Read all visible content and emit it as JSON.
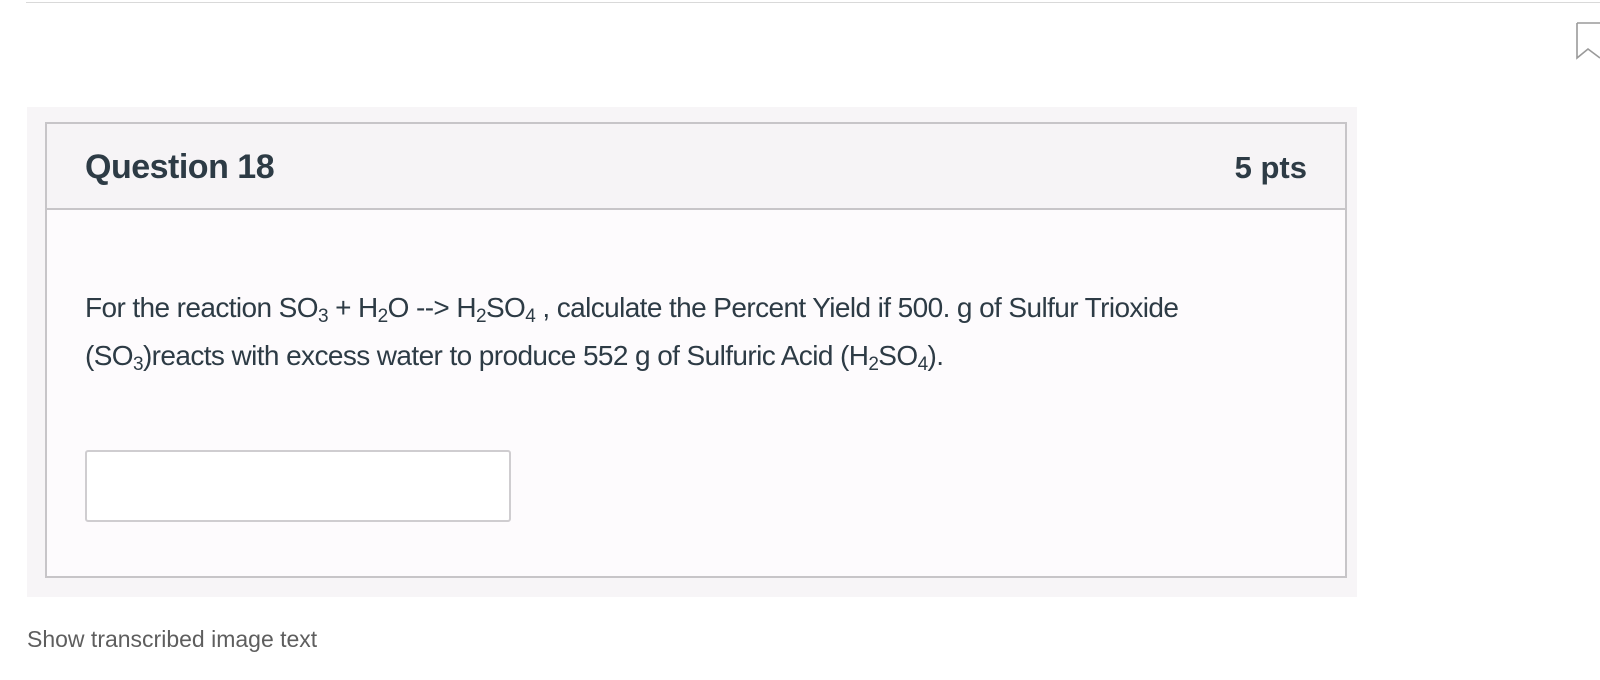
{
  "question": {
    "title": "Question 18",
    "points": "5 pts",
    "text": {
      "p1": "For the reaction SO",
      "s1": "3",
      "p2": " + H",
      "s2": "2",
      "p3": "O --> H",
      "s3": "2",
      "p4": "SO",
      "s4": "4",
      "p5": " , calculate the Percent Yield if 500. g of Sulfur Trioxide (SO",
      "s5": "3",
      "p6": ")reacts with excess water to produce 552 g of Sulfuric Acid (H",
      "s6": "2",
      "p7": "SO",
      "s7": "4",
      "p8": ")."
    },
    "answer": {
      "value": "",
      "placeholder": ""
    }
  },
  "footer": {
    "transcribed_link": "Show transcribed image text"
  },
  "icons": {
    "bookmark": "bookmark-icon"
  },
  "colors": {
    "text": "#2d3b45",
    "border": "#c7c5c8",
    "header_bg": "#f6f4f6"
  }
}
